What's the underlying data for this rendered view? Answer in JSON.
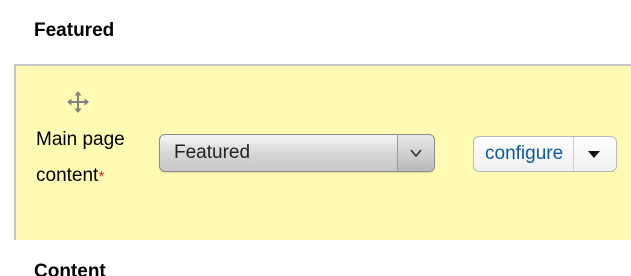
{
  "region_heading": "Featured",
  "next_region_heading": "Content",
  "block": {
    "drag_handle_icon": "move-cross-icon",
    "label": "Main page content",
    "required_marker": "*",
    "region_select": {
      "selected": "Featured",
      "arrow_icon": "chevron-down-icon"
    },
    "operations": {
      "primary_label": "configure",
      "toggle_icon": "caret-down-icon"
    }
  },
  "colors": {
    "highlight_row": "#fffbb3",
    "link": "#0a5aa8",
    "required": "#c0392b"
  }
}
